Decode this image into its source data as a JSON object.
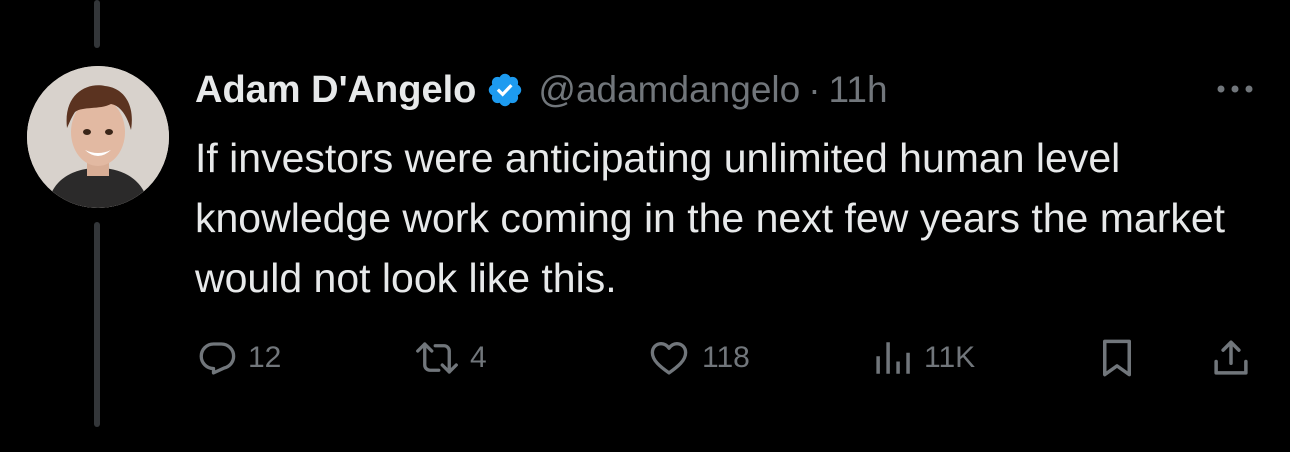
{
  "tweet": {
    "author_name": "Adam D'Angelo",
    "handle": "@adamdangelo",
    "separator": "·",
    "time": "11h",
    "text": "If investors were anticipating unlimited human level knowledge work coming in the next few years the market would not look like this.",
    "verified": true
  },
  "actions": {
    "replies": "12",
    "reposts": "4",
    "likes": "118",
    "views": "11K"
  },
  "colors": {
    "background": "#000000",
    "primary_text": "#e7e9ea",
    "secondary_text": "#71767b",
    "verified_badge": "#1d9bf0",
    "thread_line": "#333639"
  },
  "icons": [
    "verified-badge-icon",
    "more-icon",
    "reply-icon",
    "repost-icon",
    "like-icon",
    "views-icon",
    "bookmark-icon",
    "share-icon"
  ]
}
